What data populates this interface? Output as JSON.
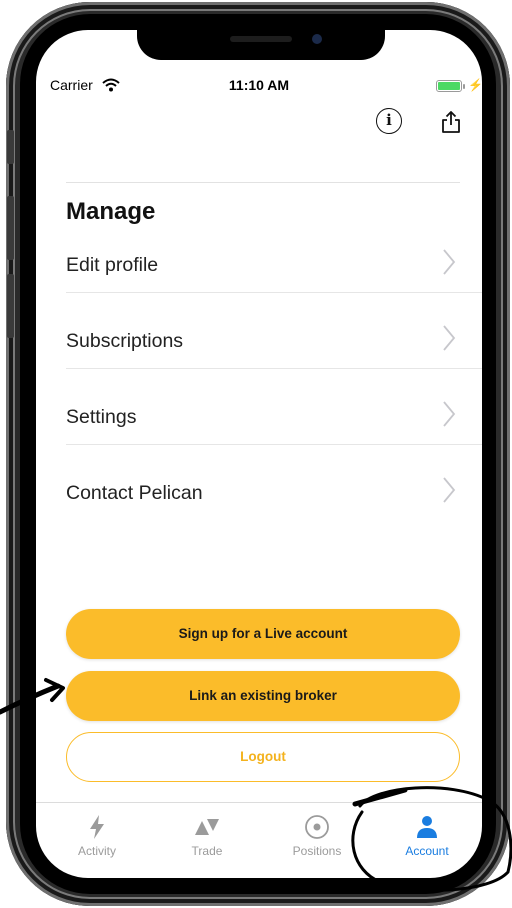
{
  "status_bar": {
    "carrier": "Carrier",
    "time": "11:10 AM",
    "battery_level": 1.0
  },
  "header": {
    "info_icon": "info-icon",
    "share_icon": "share-icon"
  },
  "manage": {
    "title": "Manage",
    "items": [
      {
        "label": "Edit profile"
      },
      {
        "label": "Subscriptions"
      },
      {
        "label": "Settings"
      },
      {
        "label": "Contact Pelican"
      }
    ]
  },
  "actions": {
    "signup_label": "Sign up for a Live account",
    "link_broker_label": "Link an existing broker",
    "logout_label": "Logout"
  },
  "tabbar": {
    "tabs": [
      {
        "label": "Activity",
        "icon": "lightning-icon",
        "active": false
      },
      {
        "label": "Trade",
        "icon": "trade-arrows-icon",
        "active": false
      },
      {
        "label": "Positions",
        "icon": "target-icon",
        "active": false
      },
      {
        "label": "Account",
        "icon": "person-icon",
        "active": true
      }
    ]
  },
  "colors": {
    "accent": "#fbbc2a",
    "active_tab": "#1a7de0",
    "inactive_tab": "#9b9b9b"
  }
}
